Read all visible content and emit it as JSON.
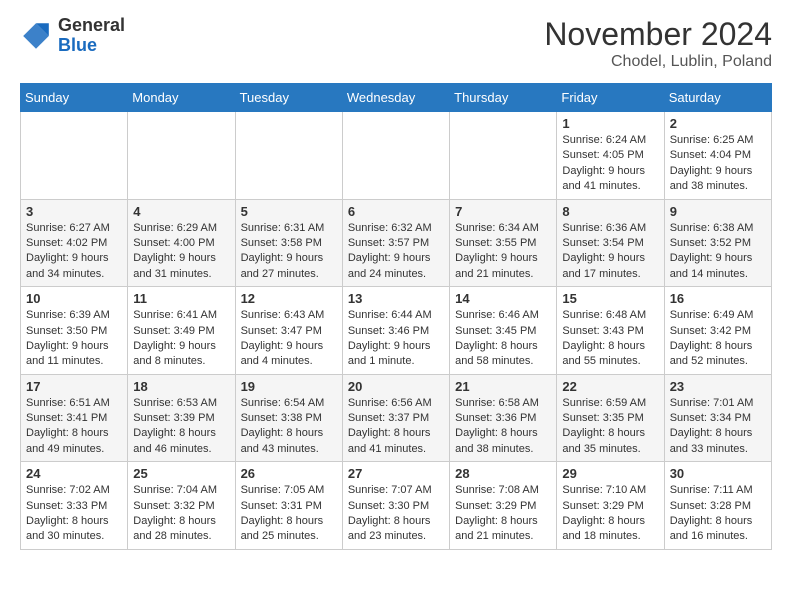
{
  "header": {
    "logo_general": "General",
    "logo_blue": "Blue",
    "month_title": "November 2024",
    "location": "Chodel, Lublin, Poland"
  },
  "days_of_week": [
    "Sunday",
    "Monday",
    "Tuesday",
    "Wednesday",
    "Thursday",
    "Friday",
    "Saturday"
  ],
  "weeks": [
    [
      {
        "day": "",
        "info": ""
      },
      {
        "day": "",
        "info": ""
      },
      {
        "day": "",
        "info": ""
      },
      {
        "day": "",
        "info": ""
      },
      {
        "day": "",
        "info": ""
      },
      {
        "day": "1",
        "info": "Sunrise: 6:24 AM\nSunset: 4:05 PM\nDaylight: 9 hours and 41 minutes."
      },
      {
        "day": "2",
        "info": "Sunrise: 6:25 AM\nSunset: 4:04 PM\nDaylight: 9 hours and 38 minutes."
      }
    ],
    [
      {
        "day": "3",
        "info": "Sunrise: 6:27 AM\nSunset: 4:02 PM\nDaylight: 9 hours and 34 minutes."
      },
      {
        "day": "4",
        "info": "Sunrise: 6:29 AM\nSunset: 4:00 PM\nDaylight: 9 hours and 31 minutes."
      },
      {
        "day": "5",
        "info": "Sunrise: 6:31 AM\nSunset: 3:58 PM\nDaylight: 9 hours and 27 minutes."
      },
      {
        "day": "6",
        "info": "Sunrise: 6:32 AM\nSunset: 3:57 PM\nDaylight: 9 hours and 24 minutes."
      },
      {
        "day": "7",
        "info": "Sunrise: 6:34 AM\nSunset: 3:55 PM\nDaylight: 9 hours and 21 minutes."
      },
      {
        "day": "8",
        "info": "Sunrise: 6:36 AM\nSunset: 3:54 PM\nDaylight: 9 hours and 17 minutes."
      },
      {
        "day": "9",
        "info": "Sunrise: 6:38 AM\nSunset: 3:52 PM\nDaylight: 9 hours and 14 minutes."
      }
    ],
    [
      {
        "day": "10",
        "info": "Sunrise: 6:39 AM\nSunset: 3:50 PM\nDaylight: 9 hours and 11 minutes."
      },
      {
        "day": "11",
        "info": "Sunrise: 6:41 AM\nSunset: 3:49 PM\nDaylight: 9 hours and 8 minutes."
      },
      {
        "day": "12",
        "info": "Sunrise: 6:43 AM\nSunset: 3:47 PM\nDaylight: 9 hours and 4 minutes."
      },
      {
        "day": "13",
        "info": "Sunrise: 6:44 AM\nSunset: 3:46 PM\nDaylight: 9 hours and 1 minute."
      },
      {
        "day": "14",
        "info": "Sunrise: 6:46 AM\nSunset: 3:45 PM\nDaylight: 8 hours and 58 minutes."
      },
      {
        "day": "15",
        "info": "Sunrise: 6:48 AM\nSunset: 3:43 PM\nDaylight: 8 hours and 55 minutes."
      },
      {
        "day": "16",
        "info": "Sunrise: 6:49 AM\nSunset: 3:42 PM\nDaylight: 8 hours and 52 minutes."
      }
    ],
    [
      {
        "day": "17",
        "info": "Sunrise: 6:51 AM\nSunset: 3:41 PM\nDaylight: 8 hours and 49 minutes."
      },
      {
        "day": "18",
        "info": "Sunrise: 6:53 AM\nSunset: 3:39 PM\nDaylight: 8 hours and 46 minutes."
      },
      {
        "day": "19",
        "info": "Sunrise: 6:54 AM\nSunset: 3:38 PM\nDaylight: 8 hours and 43 minutes."
      },
      {
        "day": "20",
        "info": "Sunrise: 6:56 AM\nSunset: 3:37 PM\nDaylight: 8 hours and 41 minutes."
      },
      {
        "day": "21",
        "info": "Sunrise: 6:58 AM\nSunset: 3:36 PM\nDaylight: 8 hours and 38 minutes."
      },
      {
        "day": "22",
        "info": "Sunrise: 6:59 AM\nSunset: 3:35 PM\nDaylight: 8 hours and 35 minutes."
      },
      {
        "day": "23",
        "info": "Sunrise: 7:01 AM\nSunset: 3:34 PM\nDaylight: 8 hours and 33 minutes."
      }
    ],
    [
      {
        "day": "24",
        "info": "Sunrise: 7:02 AM\nSunset: 3:33 PM\nDaylight: 8 hours and 30 minutes."
      },
      {
        "day": "25",
        "info": "Sunrise: 7:04 AM\nSunset: 3:32 PM\nDaylight: 8 hours and 28 minutes."
      },
      {
        "day": "26",
        "info": "Sunrise: 7:05 AM\nSunset: 3:31 PM\nDaylight: 8 hours and 25 minutes."
      },
      {
        "day": "27",
        "info": "Sunrise: 7:07 AM\nSunset: 3:30 PM\nDaylight: 8 hours and 23 minutes."
      },
      {
        "day": "28",
        "info": "Sunrise: 7:08 AM\nSunset: 3:29 PM\nDaylight: 8 hours and 21 minutes."
      },
      {
        "day": "29",
        "info": "Sunrise: 7:10 AM\nSunset: 3:29 PM\nDaylight: 8 hours and 18 minutes."
      },
      {
        "day": "30",
        "info": "Sunrise: 7:11 AM\nSunset: 3:28 PM\nDaylight: 8 hours and 16 minutes."
      }
    ]
  ]
}
